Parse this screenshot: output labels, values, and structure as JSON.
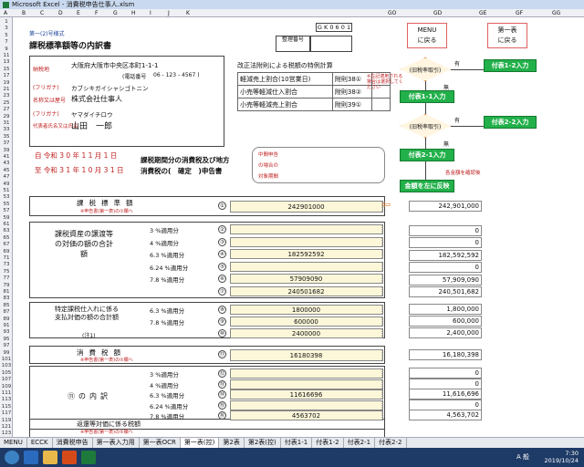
{
  "window": {
    "title": "Microsoft Excel - 消費税申告仕事人.xlsm"
  },
  "columns": [
    "A",
    "B",
    "C",
    "D",
    "E",
    "F",
    "G",
    "H",
    "I",
    "J",
    "K",
    "GO",
    "GD",
    "GE",
    "GF",
    "GG"
  ],
  "rows": [
    "1",
    "3",
    "5",
    "7",
    "9",
    "11",
    "13",
    "15",
    "17",
    "19",
    "21",
    "23",
    "25",
    "27",
    "29",
    "31",
    "33",
    "35",
    "37",
    "39",
    "41",
    "43",
    "45",
    "47",
    "49",
    "51",
    "53",
    "55",
    "57",
    "59",
    "61",
    "63",
    "65",
    "67",
    "69",
    "71",
    "73",
    "75",
    "77",
    "79",
    "81",
    "83",
    "85",
    "87",
    "89",
    "91",
    "93",
    "95",
    "97",
    "99",
    "101",
    "103",
    "105",
    "107",
    "109",
    "111",
    "113",
    "115",
    "117",
    "119",
    "121",
    "123"
  ],
  "form": {
    "subtitle": "第一(2)号様式",
    "title": "課税標準額等の内訳書",
    "form_code": "G K 0 6 0 1",
    "seiri": "整理番号",
    "address_label": "納税地",
    "address": "大阪府大阪市中央区本町1-1-1",
    "phone_label": "(電話番号",
    "phone": "06 - 123 - 4567 )",
    "furigana_label": "(フリガナ)",
    "furigana_company": "カブシキガイシャシゴトニン",
    "name_label": "名称又は屋号",
    "company": "株式会社仕事人",
    "furigana_rep": "ヤマダイチロウ",
    "rep_label": "代表者氏名又は氏名",
    "rep": "山田　一郎",
    "special_title": "改正法附則による税額の特例計算",
    "special_rows": [
      {
        "label": "軽減売上割合(10営業日)",
        "ref": "附則38①"
      },
      {
        "label": "小売等軽減仕入割合",
        "ref": "附則38②"
      },
      {
        "label": "小売等軽減売上割合",
        "ref": "附則39①"
      }
    ],
    "period_from": "自 令和 3 0 年 1 1 月 1 日",
    "period_to": "至 令和 3 1 年 1 0 月 3 1 日",
    "period_title": "課税期間分の消費税及び地方",
    "period_type": "消費税の(　確定　)申告書",
    "chukan": [
      "中間申告",
      "の場合の",
      "対象期間"
    ],
    "rows_main": [
      {
        "label": "課税標準額",
        "sub": "※申告書(第一表)の①欄へ",
        "num": "①",
        "digits": "242901000"
      }
    ],
    "section1_label": "課税資産の譲渡等の対価の額の合計額",
    "section1_rows": [
      {
        "rate": "3 %適用分",
        "num": "②",
        "digits": ""
      },
      {
        "rate": "4 %適用分",
        "num": "③",
        "digits": ""
      },
      {
        "rate": "6.3 %適用分",
        "num": "④",
        "digits": "182592592"
      },
      {
        "rate": "6.24 %適用分",
        "num": "⑤",
        "digits": ""
      },
      {
        "rate": "7.8 %適用分",
        "num": "⑥",
        "digits": "57909090"
      },
      {
        "rate": "",
        "num": "⑦",
        "digits": "240501682"
      }
    ],
    "section2_label": "特定課税仕入れに係る支払対価の額の合計額",
    "section2_note": "(注1)",
    "section2_rows": [
      {
        "rate": "6.3 %適用分",
        "num": "⑧",
        "digits": "1800000"
      },
      {
        "rate": "7.8 %適用分",
        "num": "⑨",
        "digits": "600000"
      },
      {
        "rate": "",
        "num": "⑩",
        "digits": "2400000"
      }
    ],
    "tax_label": "消費税額",
    "tax_sub": "※申告書(第一表)の②欄へ",
    "tax_row": {
      "num": "⑪",
      "digits": "16180398"
    },
    "section3_label": "⑪の内訳",
    "section3_rows": [
      {
        "rate": "3 %適用分",
        "num": "⑫",
        "digits": ""
      },
      {
        "rate": "4 %適用分",
        "num": "⑬",
        "digits": ""
      },
      {
        "rate": "6.3 %適用分",
        "num": "⑭",
        "digits": "11616696"
      },
      {
        "rate": "6.24 %適用分",
        "num": "⑮",
        "digits": ""
      },
      {
        "rate": "7.8 %適用分",
        "num": "⑯",
        "digits": "4563702"
      }
    ],
    "bottom_label": "返還等対価に係る税額",
    "bottom_sub": "※申告書(第一表)の⑤欄へ"
  },
  "flow": {
    "menu": "MENU\nに戻る",
    "first_table": "第一表\nに戻る",
    "d1": "(旧税率取引)",
    "d2": "(旧税率取引)",
    "yes": "有",
    "no": "無",
    "btn_12": "付表1-2入力",
    "btn_11": "付表1-1入力",
    "btn_22": "付表2-2入力",
    "btn_21": "付表2-1入力",
    "reflect": "金額を左に反映",
    "note": "※左記適用される場合は選択してください",
    "note2": "各金額を確認後"
  },
  "results": [
    "242,901,000",
    "0",
    "0",
    "182,592,592",
    "0",
    "57,909,090",
    "240,501,682",
    "1,800,000",
    "600,000",
    "2,400,000",
    "16,180,398",
    "0",
    "0",
    "11,616,696",
    "0",
    "4,563,702"
  ],
  "tabs": [
    "MENU",
    "ECCK",
    "消費税申告",
    "第一表入力用",
    "第一表OCR",
    "第一表(控)",
    "第2表",
    "第2表(控)",
    "付表1-1",
    "付表1-2",
    "付表2-1",
    "付表2-2"
  ],
  "active_tab": "第一表(控)",
  "taskbar": {
    "time": "7:30",
    "date": "2019/10/24",
    "ime": "A 般"
  }
}
